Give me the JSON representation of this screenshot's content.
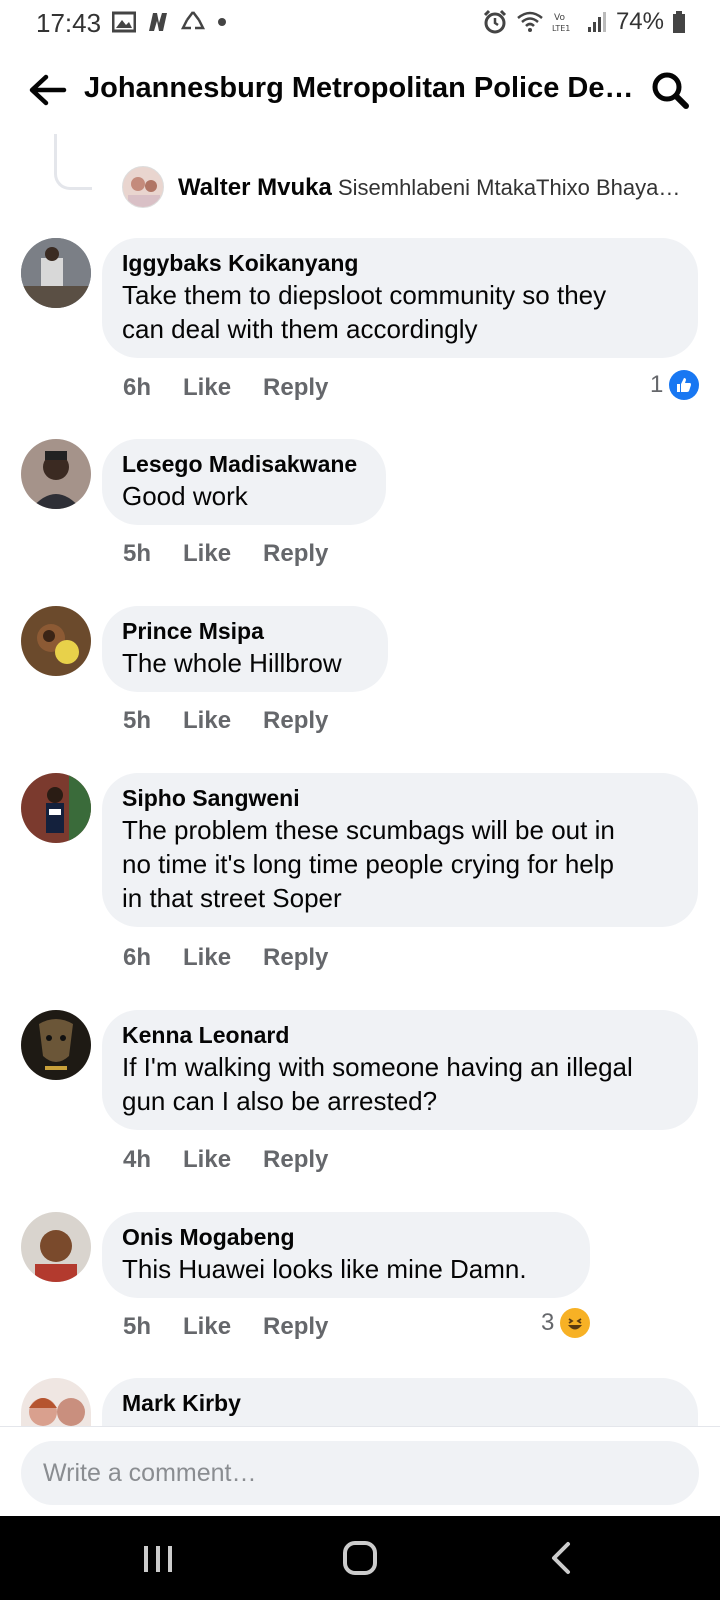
{
  "status_bar": {
    "time": "17:43",
    "battery": "74%",
    "left_icons": [
      "gallery-icon",
      "netflix-icon",
      "recycle-icon",
      "dot-icon"
    ],
    "right_icons": [
      "alarm-icon",
      "wifi-icon",
      "volte-icon",
      "signal-icon",
      "battery-icon"
    ]
  },
  "header": {
    "title": "Johannesburg Metropolitan Police Dep…",
    "back_icon": "arrow-left-icon",
    "search_icon": "search-icon"
  },
  "reply_preview": {
    "name": "Walter Mvuka",
    "text": "Sisemhlabeni MtakaThixo Bhaya…"
  },
  "comments": [
    {
      "name": "Iggybaks Koikanyang",
      "text_lines": [
        "Take them to diepsloot community so they",
        "can deal with them accordingly"
      ],
      "time": "6h",
      "like": "Like",
      "reply": "Reply",
      "reaction_count": "1",
      "reaction": "like-reaction-icon",
      "avatar_color": "#6f7a88"
    },
    {
      "name": "Lesego Madisakwane",
      "text_lines": [
        "Good work"
      ],
      "time": "5h",
      "like": "Like",
      "reply": "Reply",
      "avatar_color": "#8a6d5e"
    },
    {
      "name": "Prince Msipa",
      "text_lines": [
        "The whole Hillbrow"
      ],
      "time": "5h",
      "like": "Like",
      "reply": "Reply",
      "avatar_color": "#8c6b3d"
    },
    {
      "name": "Sipho Sangweni",
      "text_lines": [
        "The problem these scumbags will be out in",
        "no time it's long time people crying for help",
        "in that street Soper"
      ],
      "time": "6h",
      "like": "Like",
      "reply": "Reply",
      "avatar_color": "#b93b3b"
    },
    {
      "name": "Kenna Leonard",
      "text_lines": [
        "If I'm walking with someone having an illegal",
        "gun can I also be arrested?"
      ],
      "time": "4h",
      "like": "Like",
      "reply": "Reply",
      "avatar_color": "#2c2418"
    },
    {
      "name": "Onis Mogabeng",
      "text_lines": [
        "This Huawei looks like mine  Damn."
      ],
      "time": "5h",
      "like": "Like",
      "reply": "Reply",
      "reaction_count": "3",
      "reaction": "haha-reaction-icon",
      "avatar_color": "#a4653f"
    },
    {
      "name": "Mark Kirby",
      "text_lines": [],
      "avatar_color": "#d6a79a"
    }
  ],
  "composer": {
    "placeholder": "Write a comment…"
  },
  "nav_bar": {
    "recents_icon": "recents-icon",
    "home_icon": "home-icon",
    "back_icon": "nav-back-icon"
  }
}
